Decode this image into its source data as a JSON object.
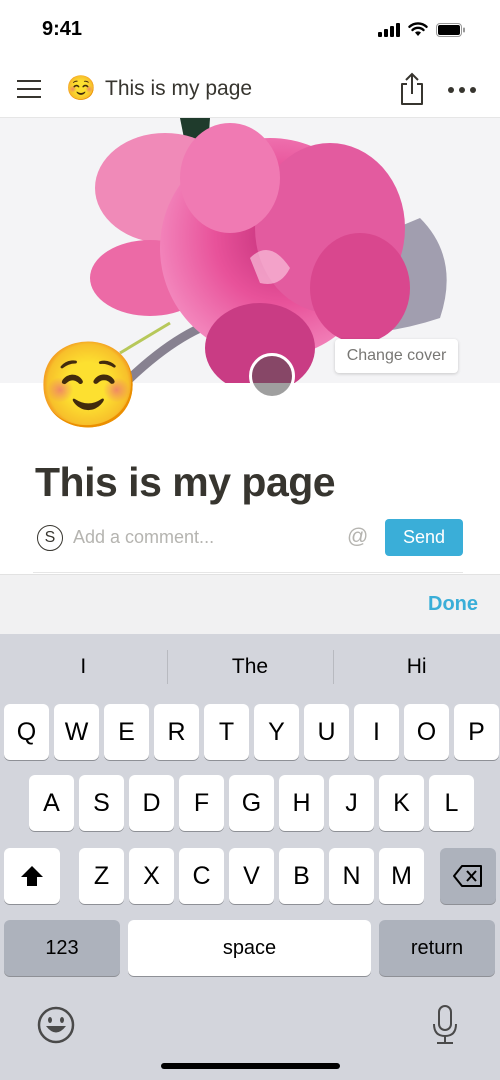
{
  "status_bar": {
    "time": "9:41",
    "icons": [
      "cellular-signal-icon",
      "wifi-icon",
      "battery-icon"
    ]
  },
  "nav": {
    "menu_icon": "hamburger-menu-icon",
    "page_emoji": "☺️",
    "title": "This is my page",
    "share_icon": "share-icon",
    "more_icon": "more-horizontal-icon"
  },
  "cover": {
    "change_cover_label": "Change cover",
    "colors": {
      "petal": "#e8529a",
      "petal_light": "#f48cc0",
      "petal_dark": "#c3307a",
      "background": "#f4f4f6",
      "shadow": "#5c5775",
      "stem": "#b7c85a",
      "leaf": "#1f3b2c"
    }
  },
  "page": {
    "icon_emoji": "☺️",
    "title": "This is my page"
  },
  "comment": {
    "avatar_letter": "S",
    "placeholder": "Add a comment...",
    "value": "",
    "mention_symbol": "@",
    "send_label": "Send"
  },
  "accessory": {
    "done_label": "Done"
  },
  "keyboard": {
    "suggestions": [
      "I",
      "The",
      "Hi"
    ],
    "row1": [
      "Q",
      "W",
      "E",
      "R",
      "T",
      "Y",
      "U",
      "I",
      "O",
      "P"
    ],
    "row2": [
      "A",
      "S",
      "D",
      "F",
      "G",
      "H",
      "J",
      "K",
      "L"
    ],
    "row3": [
      "Z",
      "X",
      "C",
      "V",
      "B",
      "N",
      "M"
    ],
    "shift_icon": "shift-icon",
    "backspace_icon": "backspace-icon",
    "numbers_label": "123",
    "space_label": "space",
    "return_label": "return",
    "emoji_icon": "emoji-keyboard-icon",
    "mic_icon": "microphone-icon"
  },
  "colors": {
    "accent": "#3aaed8",
    "text": "#37352f",
    "muted": "#b5b4b0",
    "keyboard_bg": "#d3d5dc",
    "key_dark": "#adb2bc"
  }
}
